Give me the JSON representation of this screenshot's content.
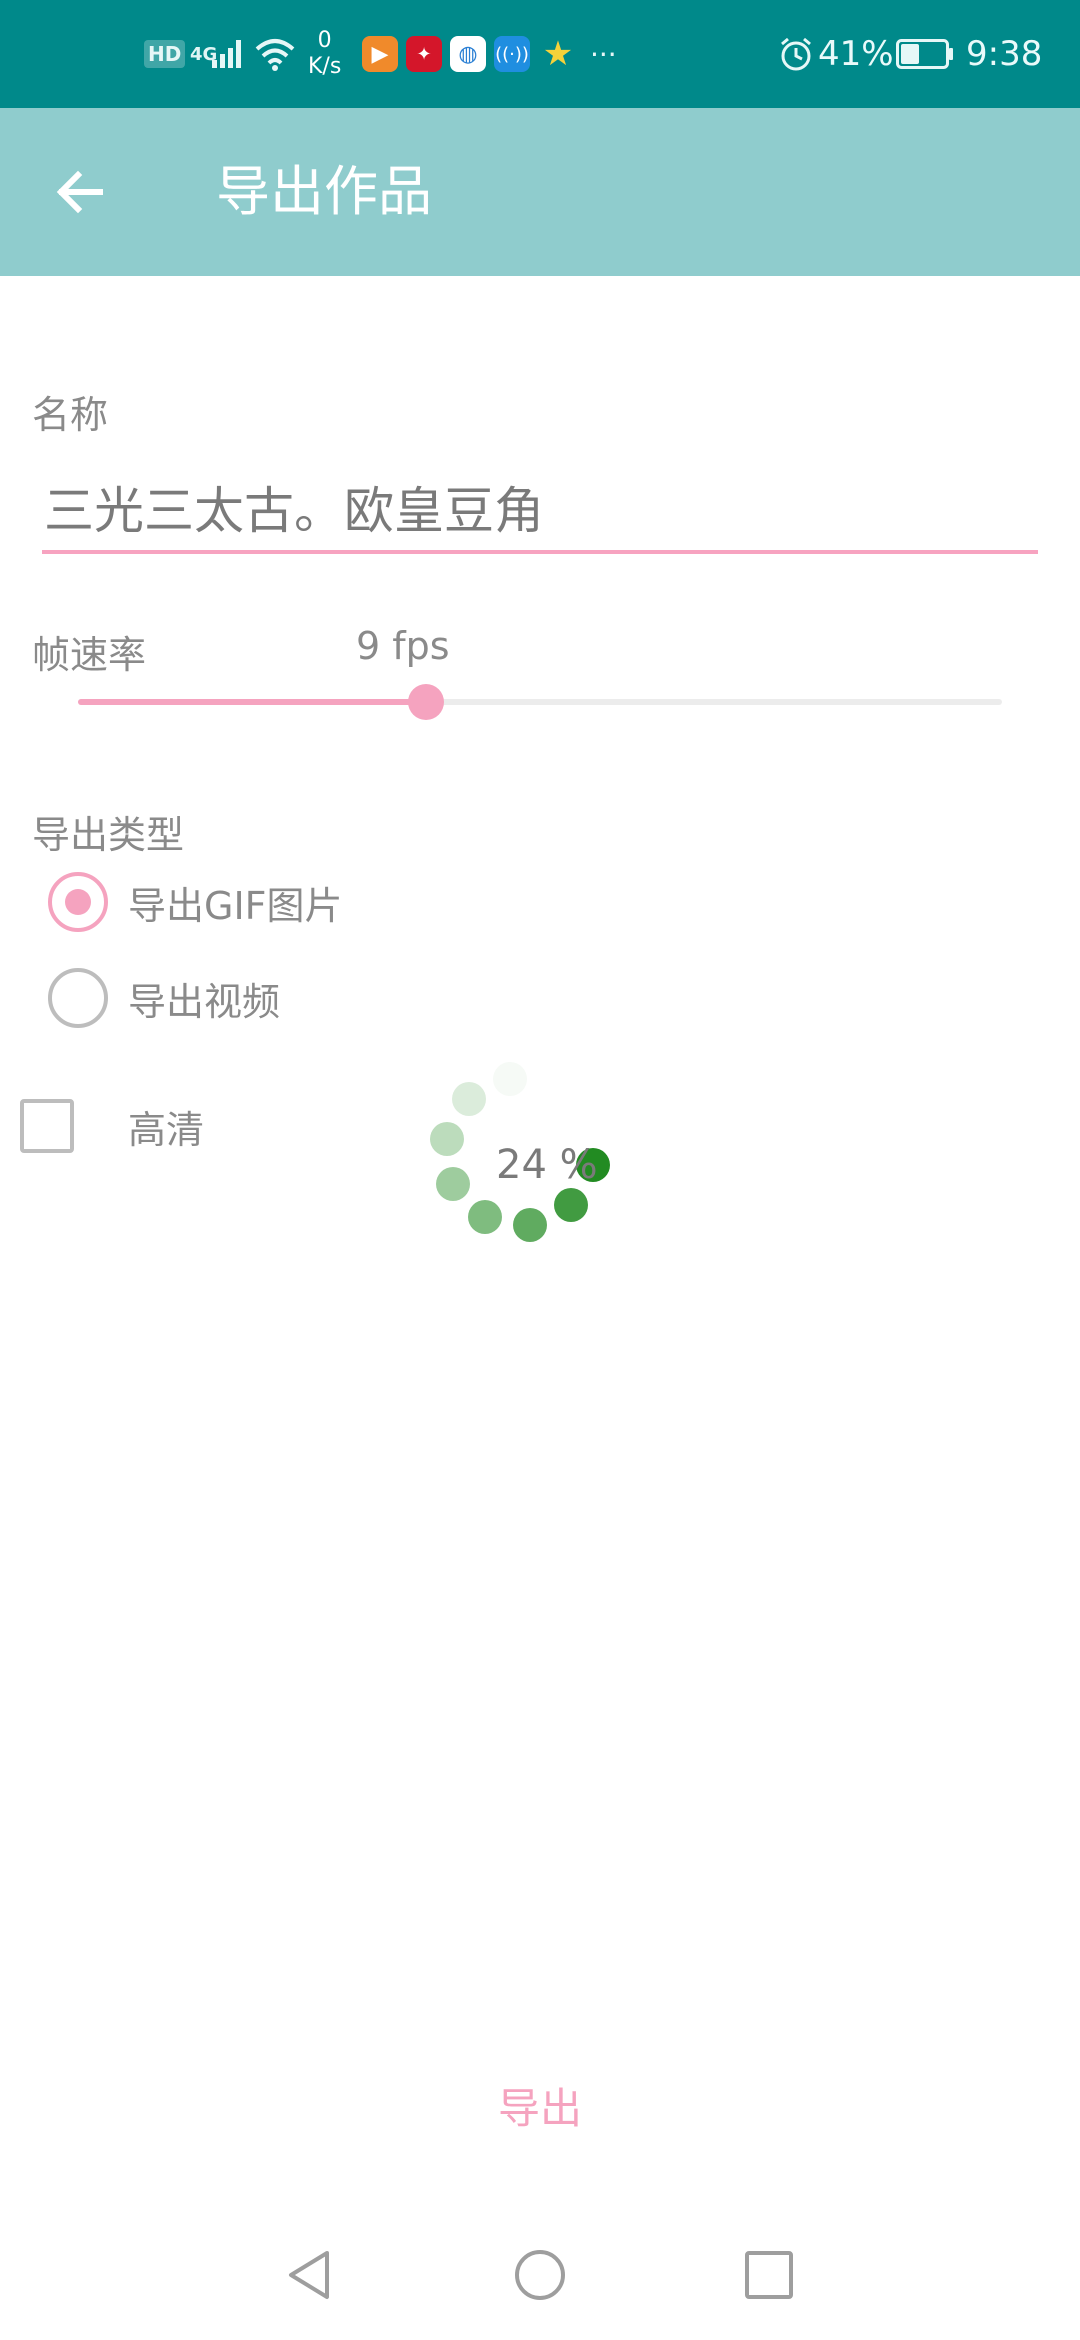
{
  "status_bar": {
    "hd": "HD",
    "network": "4G",
    "speed_value": "0",
    "speed_unit": "K/s",
    "more": "···",
    "battery": "41%",
    "time": "9:38",
    "battery_level": 0.41
  },
  "app_bar": {
    "title": "导出作品"
  },
  "form": {
    "name_label": "名称",
    "name_value": "三光三太古。欧皇豆角",
    "fps_label": "帧速率",
    "fps_value": "9 fps",
    "fps_slider_fraction": 0.377,
    "type_label": "导出类型",
    "type_options": [
      {
        "label": "导出GIF图片",
        "selected": true
      },
      {
        "label": "导出视频",
        "selected": false
      }
    ],
    "hd_label": "高清",
    "hd_checked": false
  },
  "progress": {
    "text": "24 %",
    "percent": 24,
    "color": "#228b22"
  },
  "actions": {
    "export_label": "导出"
  },
  "colors": {
    "status_bar": "#00898a",
    "app_bar": "#8fcccd",
    "accent": "#f5a3bf"
  }
}
